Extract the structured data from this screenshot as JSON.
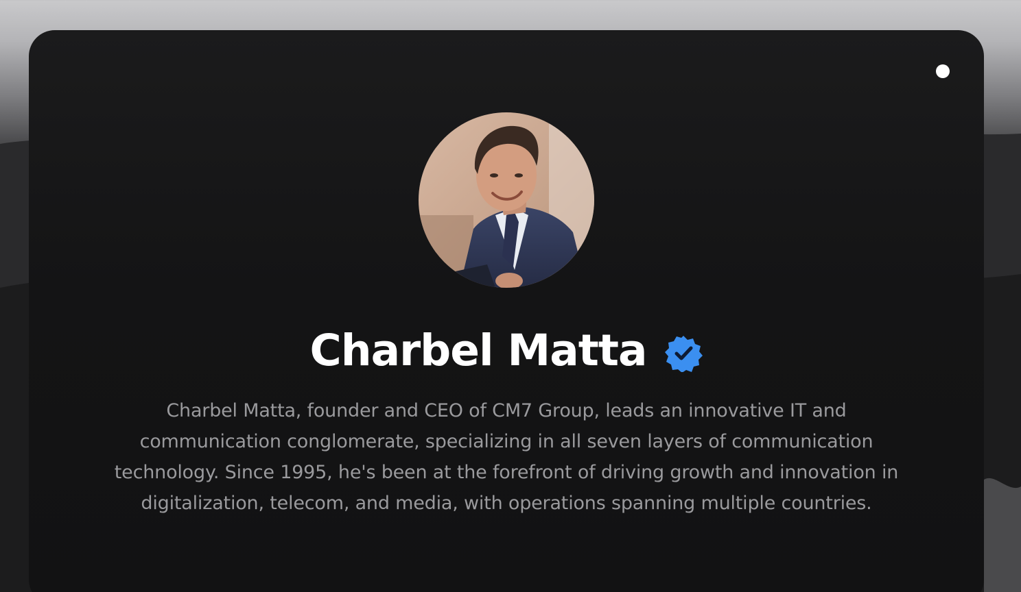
{
  "profile": {
    "name": "Charbel Matta",
    "verified": true,
    "bio": "Charbel Matta, founder and CEO of CM7 Group, leads an innovative IT and communication conglomerate, specializing in all seven layers of communication technology. Since 1995, he's been at the forefront of driving growth and innovation in digitalization, telecom, and media, with operations spanning multiple countries.",
    "avatar_icon": "profile-photo"
  },
  "colors": {
    "card_background": "#141415",
    "name": "#ffffff",
    "bio": "#9a9a9d",
    "verified_badge": "#3b8ff0",
    "status_dot": "#ffffff"
  }
}
